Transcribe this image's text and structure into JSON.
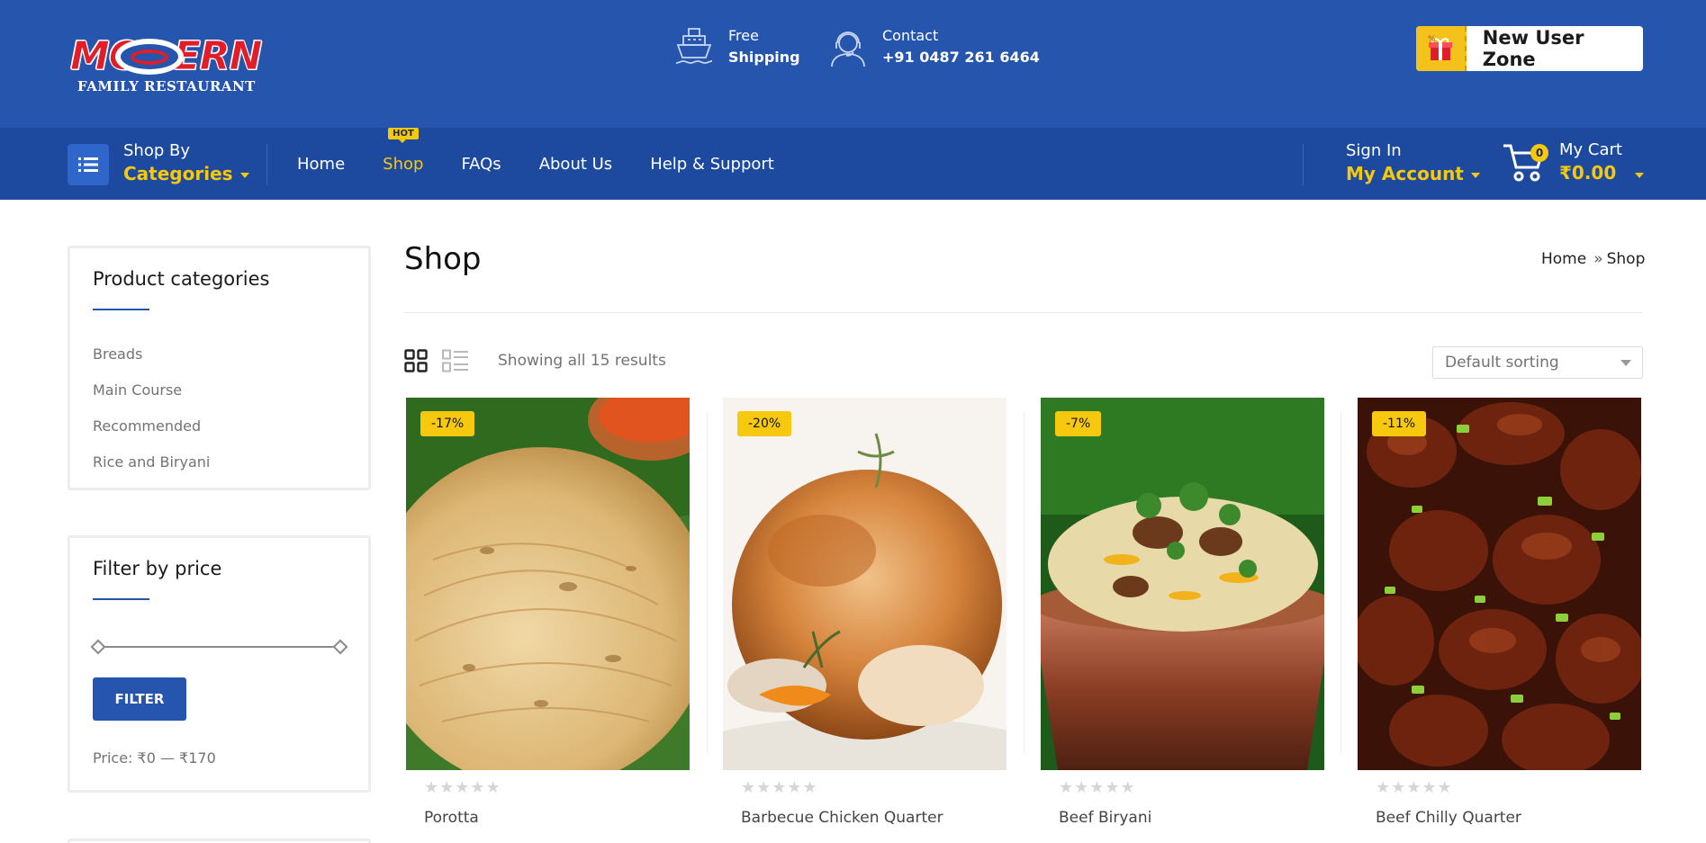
{
  "header": {
    "logo": {
      "wordmark": "MODERN",
      "subtitle": "FAMILY RESTAURANT"
    },
    "shipping": {
      "line1": "Free",
      "line2": "Shipping",
      "icon": "ship-icon"
    },
    "contact": {
      "line1": "Contact",
      "line2": "+91 0487 261 6464",
      "icon": "support-agent-icon"
    },
    "new_user_zone": "New User Zone"
  },
  "nav": {
    "shop_by": "Shop By",
    "categories": "Categories",
    "links": [
      {
        "label": "Home"
      },
      {
        "label": "Shop",
        "badge": "HOT"
      },
      {
        "label": "FAQs"
      },
      {
        "label": "About Us"
      },
      {
        "label": "Help & Support"
      }
    ],
    "sign_in": "Sign In",
    "my_account": "My Account",
    "cart": {
      "label": "My Cart",
      "total": "₹0.00",
      "count": "0"
    }
  },
  "sidebar": {
    "categories_title": "Product categories",
    "categories": [
      "Breads",
      "Main Course",
      "Recommended",
      "Rice and Biryani"
    ],
    "filter_title": "Filter by price",
    "filter_button": "FILTER",
    "price_text": "Price: ₹0 — ₹170"
  },
  "main": {
    "title": "Shop",
    "breadcrumb": {
      "home": "Home",
      "separator": "»",
      "current": "Shop"
    },
    "results_text": "Showing all 15 results",
    "sorting": "Default sorting",
    "products": [
      {
        "name": "Porotta",
        "discount": "-17%",
        "rating": 0
      },
      {
        "name": "Barbecue Chicken Quarter",
        "discount": "-20%",
        "rating": 0
      },
      {
        "name": "Beef Biryani",
        "discount": "-7%",
        "rating": 0
      },
      {
        "name": "Beef Chilly Quarter",
        "discount": "-11%",
        "rating": 0
      }
    ]
  },
  "colors": {
    "header_bg": "#2555ad",
    "nav_bg": "#1d4a9e",
    "accent_yellow": "#f6c90e",
    "logo_red": "#e11d2a"
  }
}
